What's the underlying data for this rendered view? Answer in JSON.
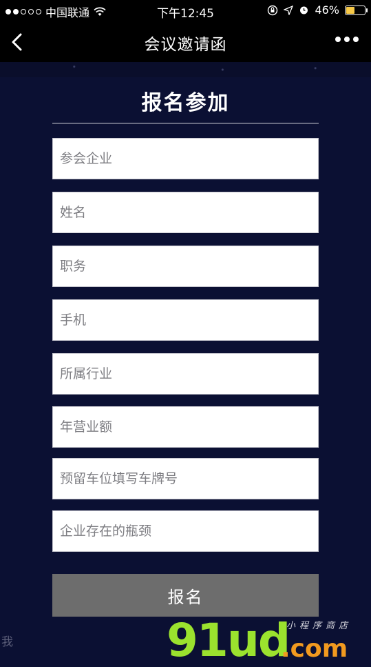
{
  "status_bar": {
    "carrier": "中国联通",
    "time": "下午12:45",
    "battery_percent": "46%",
    "battery_level": 0.46
  },
  "nav": {
    "title": "会议邀请函"
  },
  "form": {
    "heading": "报名参加",
    "fields": [
      {
        "placeholder": "参会企业"
      },
      {
        "placeholder": "姓名"
      },
      {
        "placeholder": "职务"
      },
      {
        "placeholder": "手机"
      },
      {
        "placeholder": "所属行业"
      },
      {
        "placeholder": "年营业额"
      },
      {
        "placeholder": "预留车位填写车牌号"
      },
      {
        "placeholder": "企业存在的瓶颈"
      }
    ],
    "submit_label": "报名"
  },
  "footer": {
    "left_char": "我"
  },
  "watermark": {
    "main": "91ud",
    "suffix": ".com",
    "small": "小程序商店"
  },
  "colors": {
    "background": "#0b1033",
    "submit_button": "#6d6d6d",
    "battery": "#f7c948"
  }
}
